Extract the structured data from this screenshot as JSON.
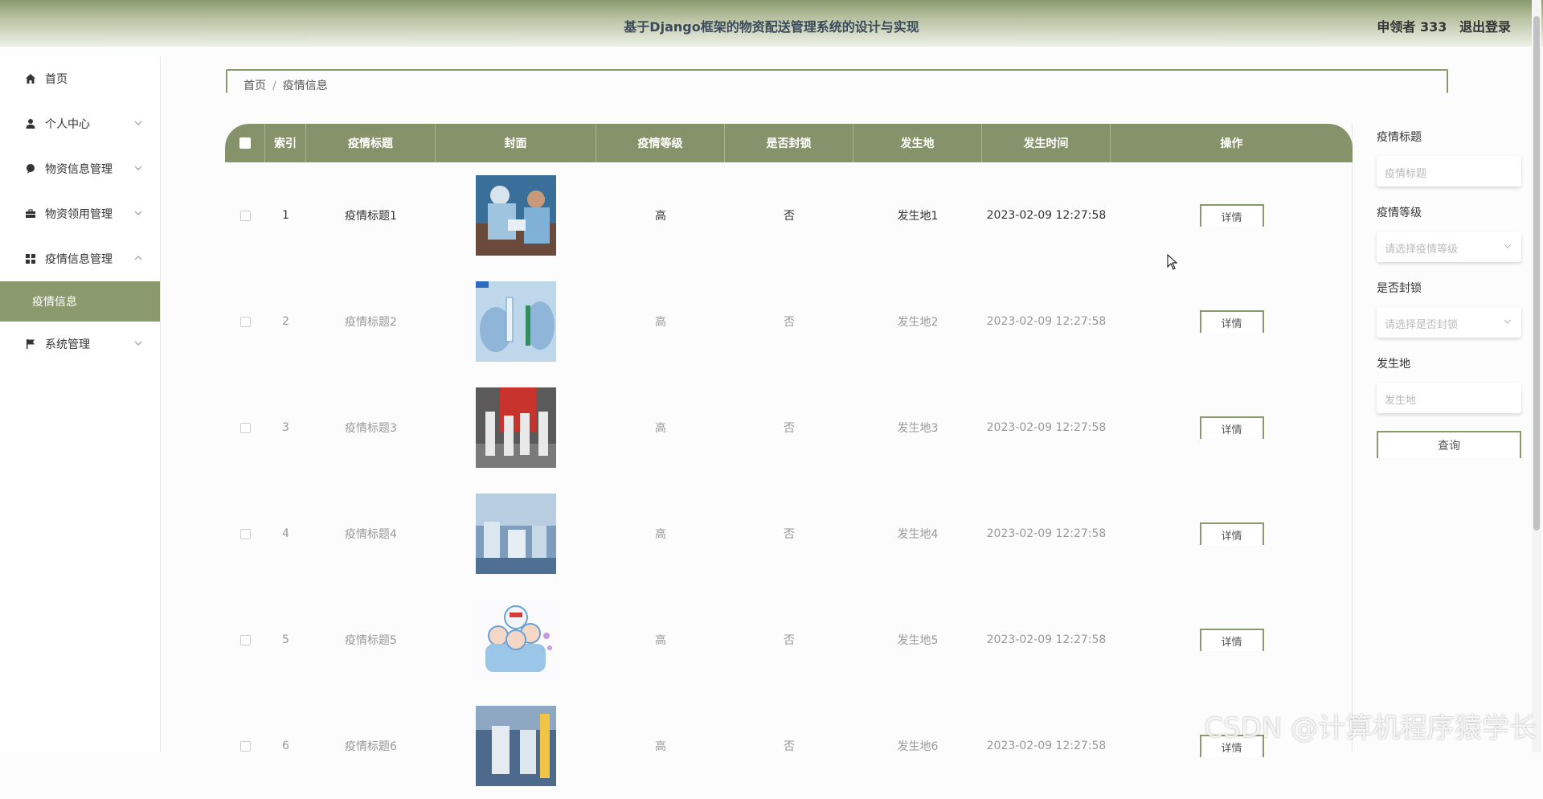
{
  "header": {
    "title": "基于Django框架的物资配送管理系统的设计与实现",
    "user": "申领者 333",
    "logout": "退出登录"
  },
  "sidebar": {
    "items": [
      {
        "label": "首页",
        "icon": "home-icon"
      },
      {
        "label": "个人中心",
        "icon": "user-icon"
      },
      {
        "label": "物资信息管理",
        "icon": "pin-icon"
      },
      {
        "label": "物资领用管理",
        "icon": "briefcase-icon"
      },
      {
        "label": "疫情信息管理",
        "icon": "grid-icon"
      },
      {
        "label": "疫情信息",
        "icon": ""
      },
      {
        "label": "系统管理",
        "icon": "flag-icon"
      }
    ]
  },
  "breadcrumb": {
    "home": "首页",
    "sep": "/",
    "current": "疫情信息"
  },
  "table": {
    "headers": [
      "",
      "索引",
      "疫情标题",
      "封面",
      "疫情等级",
      "是否封锁",
      "发生地",
      "发生时间",
      "操作"
    ],
    "detail_label": "详情",
    "rows": [
      {
        "index": "1",
        "title": "疫情标题1",
        "level": "高",
        "lockdown": "否",
        "place": "发生地1",
        "time": "2023-02-09 12:27:58"
      },
      {
        "index": "2",
        "title": "疫情标题2",
        "level": "高",
        "lockdown": "否",
        "place": "发生地2",
        "time": "2023-02-09 12:27:58"
      },
      {
        "index": "3",
        "title": "疫情标题3",
        "level": "高",
        "lockdown": "否",
        "place": "发生地3",
        "time": "2023-02-09 12:27:58"
      },
      {
        "index": "4",
        "title": "疫情标题4",
        "level": "高",
        "lockdown": "否",
        "place": "发生地4",
        "time": "2023-02-09 12:27:58"
      },
      {
        "index": "5",
        "title": "疫情标题5",
        "level": "高",
        "lockdown": "否",
        "place": "发生地5",
        "time": "2023-02-09 12:27:58"
      },
      {
        "index": "6",
        "title": "疫情标题6",
        "level": "高",
        "lockdown": "否",
        "place": "发生地6",
        "time": "2023-02-09 12:27:58"
      }
    ]
  },
  "filters": {
    "title_label": "疫情标题",
    "title_placeholder": "疫情标题",
    "level_label": "疫情等级",
    "level_placeholder": "请选择疫情等级",
    "lock_label": "是否封锁",
    "lock_placeholder": "请选择是否封锁",
    "place_label": "发生地",
    "place_placeholder": "发生地",
    "search_button": "查询"
  },
  "watermark": "CSDN @计算机程序猿学长",
  "colors": {
    "accent": "#86936a",
    "accent_light": "#8a9a6c"
  }
}
